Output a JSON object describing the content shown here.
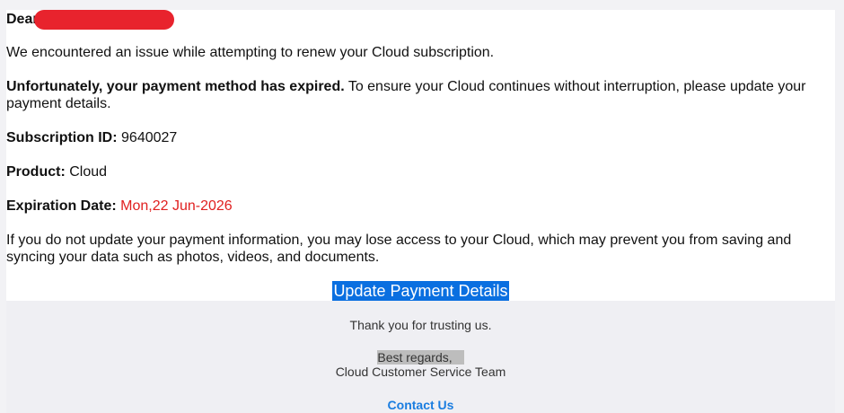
{
  "email": {
    "greeting": "Dear",
    "intro": "We encountered an issue while attempting to renew your Cloud subscription.",
    "warning_bold": "Unfortunately, your payment method has expired.",
    "warning_rest": " To ensure your Cloud continues without interruption, please update your payment details.",
    "fields": {
      "subscription_label": "Subscription ID:",
      "subscription_value": "9640027",
      "product_label": "Product:",
      "product_value": "Cloud",
      "expiration_label": "Expiration Date:",
      "expiration_value": "Mon,22 Jun-2026"
    },
    "consequence": "If you do not update your payment information, you may lose access to your Cloud, which may prevent you from saving and syncing your data such as photos, videos, and documents.",
    "cta_label": "Update Payment Details"
  },
  "footer": {
    "thanks": "Thank you for trusting us.",
    "regards": "Best regards,",
    "team": "Cloud Customer Service Team",
    "contact_label": "Contact Us"
  },
  "colors": {
    "cta_background": "#0a6fe0",
    "expiration_text": "#e02020",
    "redaction": "#e8232d",
    "contact_link": "#1a7de0"
  }
}
